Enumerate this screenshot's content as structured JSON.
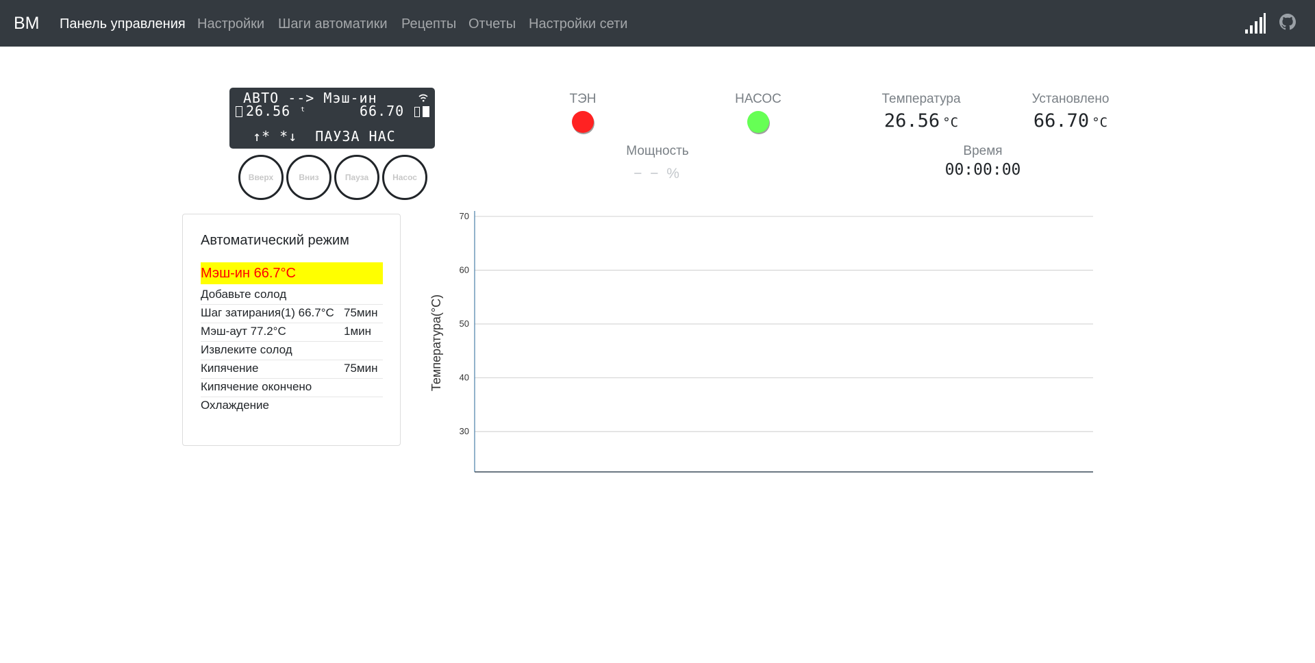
{
  "navbar": {
    "brand": "BM",
    "items": [
      {
        "label": "Панель управления",
        "active": true
      },
      {
        "label": "Настройки"
      },
      {
        "label": "Шаги автоматики"
      },
      {
        "label": "Рецепты"
      },
      {
        "label": "Отчеты"
      },
      {
        "label": "Настройки сети"
      }
    ],
    "icons": [
      "signal-strength-icon",
      "github-icon"
    ]
  },
  "lcd": {
    "line1": "АВТО --> Мэш-ин",
    "line2_left": "26.56",
    "line2_right": "66.70",
    "line3": "↑* *↓  ПАУЗА НАС"
  },
  "buttons": {
    "up": "Вверх",
    "down": "Вниз",
    "pause": "Пауза",
    "pump": "Насос"
  },
  "status": {
    "heater_label": "ТЭН",
    "heater_color": "#ff2222",
    "pump_label": "НАСОС",
    "pump_color": "#66ff55",
    "temp_label": "Температура",
    "temp_value": "26.56",
    "temp_unit": "°C",
    "set_label": "Установлено",
    "set_value": "66.70",
    "set_unit": "°C",
    "power_label": "Мощность",
    "power_value": "− − %",
    "time_label": "Время",
    "time_value": "00:00:00"
  },
  "steps": {
    "title": "Автоматический режим",
    "current": "Мэш-ин 66.7°C",
    "items": [
      {
        "name": "Добавьте солод",
        "time": ""
      },
      {
        "name": "Шаг затирания(1) 66.7°C",
        "time": "75мин"
      },
      {
        "name": "Мэш-аут 77.2°C",
        "time": "1мин"
      },
      {
        "name": "Извлеките солод",
        "time": ""
      },
      {
        "name": "Кипячение",
        "time": "75мин"
      },
      {
        "name": "Кипячение окончено",
        "time": ""
      },
      {
        "name": "Охлаждение",
        "time": ""
      }
    ]
  },
  "chart_data": {
    "type": "line",
    "title": "",
    "xlabel": "",
    "ylabel": "Температура(°C)",
    "ylim": [
      22.5,
      70.5
    ],
    "yticks": [
      30,
      40,
      50,
      60,
      70
    ],
    "grid": true,
    "series": [],
    "accent_color": "#4a7fa8"
  }
}
